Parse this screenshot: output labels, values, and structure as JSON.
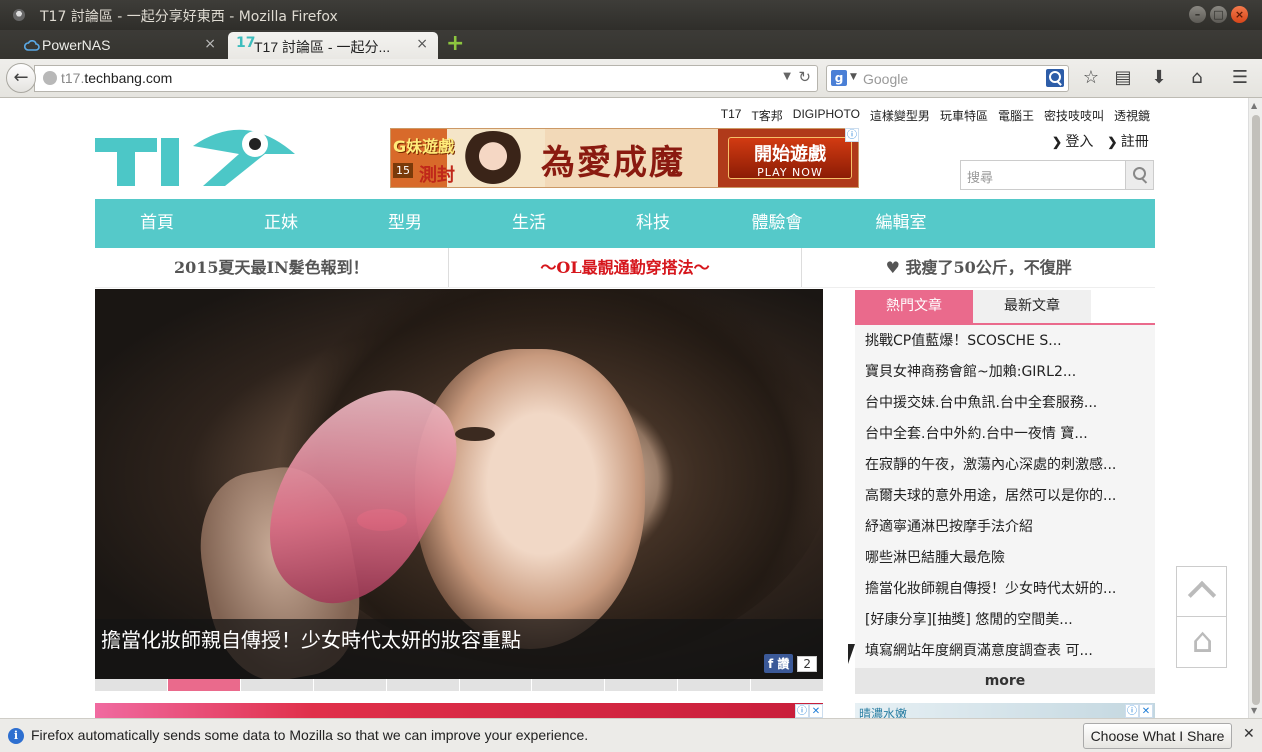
{
  "window": {
    "title": "T17 討論區 - 一起分享好東西 - Mozilla Firefox"
  },
  "tabs": [
    {
      "label": "PowerNAS"
    },
    {
      "label": "T17 討論區 - 一起分..."
    }
  ],
  "navbar": {
    "url_dim": "t17.",
    "url_host": "techbang.com",
    "search_placeholder": "Google"
  },
  "page": {
    "toplinks": [
      "T17",
      "T客邦",
      "DIGIPHOTO",
      "這樣變型男",
      "玩車特區",
      "電腦王",
      "密技吱吱叫",
      "透視鏡"
    ],
    "logo_text": "T17",
    "ad1": {
      "brand": "G妹遊戲",
      "level": "15",
      "level_text": "測封",
      "headline": "為愛成魔",
      "cta_main": "開始遊戲",
      "cta_sub": "PLAY NOW"
    },
    "auth": {
      "login": "登入",
      "register": "註冊"
    },
    "site_search_placeholder": "搜尋",
    "mainnav": [
      "首頁",
      "正妹",
      "型男",
      "生活",
      "科技",
      "體驗會",
      "編輯室"
    ],
    "promos": [
      "2015夏天最IN髮色報到！",
      "～OL最靚通勤穿搭法～",
      "♥ 我瘦了50公斤，不復胖"
    ],
    "hero": {
      "caption": "擔當化妝師親自傳授！少女時代太妍的妝容重點",
      "share_label": "f 讚",
      "share_count": "2"
    },
    "sidebar": {
      "tab_hot": "熱門文章",
      "tab_new": "最新文章",
      "items": [
        "挑戰CP值藍爆！SCOSCHE S...",
        "寶貝女神商務會館~加賴:GIRL2...",
        "台中援交妹.台中魚訊.台中全套服務...",
        "台中全套.台中外約.台中一夜情 寶...",
        "在寂靜的午夜，激蕩內心深處的刺激感...",
        "高爾夫球的意外用途，居然可以是你的...",
        "紓適寧通淋巴按摩手法介紹",
        "哪些淋巴結腫大最危險",
        "擔當化妝師親自傳授！少女時代太妍的...",
        "[好康分享][抽獎] 悠閒的空間美...",
        "填寫網站年度網頁滿意度調查表 可..."
      ],
      "more": "more"
    },
    "ad3_text": "晴濃水嫩"
  },
  "notification": {
    "message": "Firefox automatically sends some data to Mozilla so that we can improve your experience.",
    "button": "Choose What I Share"
  }
}
